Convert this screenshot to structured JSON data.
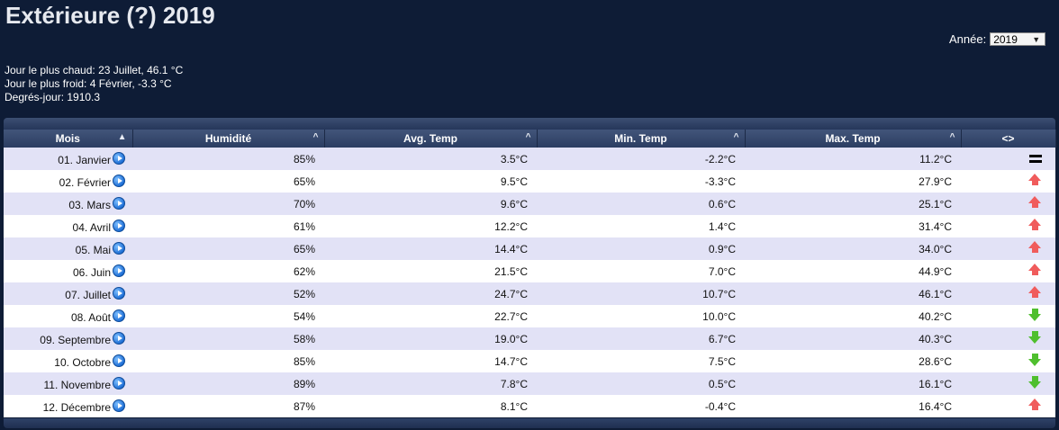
{
  "title": "Extérieure (?) 2019",
  "year_selector": {
    "label": "Année:",
    "value": "2019"
  },
  "stats": [
    "Jour le plus chaud: 23 Juillet, 46.1 °C",
    "Jour le plus froid: 4 Février, -3.3 °C",
    "Degrés-jour: 1910.3"
  ],
  "table": {
    "headers": [
      "Mois",
      "Humidité",
      "Avg. Temp",
      "Min. Temp",
      "Max. Temp",
      "<>"
    ],
    "rows": [
      {
        "mois": "01. Janvier",
        "humidite": "85%",
        "avg": "3.5°C",
        "min": "-2.2°C",
        "max": "11.2°C",
        "trend": "equal"
      },
      {
        "mois": "02. Février",
        "humidite": "65%",
        "avg": "9.5°C",
        "min": "-3.3°C",
        "max": "27.9°C",
        "trend": "up"
      },
      {
        "mois": "03. Mars",
        "humidite": "70%",
        "avg": "9.6°C",
        "min": "0.6°C",
        "max": "25.1°C",
        "trend": "up"
      },
      {
        "mois": "04. Avril",
        "humidite": "61%",
        "avg": "12.2°C",
        "min": "1.4°C",
        "max": "31.4°C",
        "trend": "up"
      },
      {
        "mois": "05. Mai",
        "humidite": "65%",
        "avg": "14.4°C",
        "min": "0.9°C",
        "max": "34.0°C",
        "trend": "up"
      },
      {
        "mois": "06. Juin",
        "humidite": "62%",
        "avg": "21.5°C",
        "min": "7.0°C",
        "max": "44.9°C",
        "trend": "up"
      },
      {
        "mois": "07. Juillet",
        "humidite": "52%",
        "avg": "24.7°C",
        "min": "10.7°C",
        "max": "46.1°C",
        "trend": "up"
      },
      {
        "mois": "08. Août",
        "humidite": "54%",
        "avg": "22.7°C",
        "min": "10.0°C",
        "max": "40.2°C",
        "trend": "down"
      },
      {
        "mois": "09. Septembre",
        "humidite": "58%",
        "avg": "19.0°C",
        "min": "6.7°C",
        "max": "40.3°C",
        "trend": "down"
      },
      {
        "mois": "10. Octobre",
        "humidite": "85%",
        "avg": "14.7°C",
        "min": "7.5°C",
        "max": "28.6°C",
        "trend": "down"
      },
      {
        "mois": "11. Novembre",
        "humidite": "89%",
        "avg": "7.8°C",
        "min": "0.5°C",
        "max": "16.1°C",
        "trend": "down"
      },
      {
        "mois": "12. Décembre",
        "humidite": "87%",
        "avg": "8.1°C",
        "min": "-0.4°C",
        "max": "16.4°C",
        "trend": "up"
      }
    ]
  }
}
